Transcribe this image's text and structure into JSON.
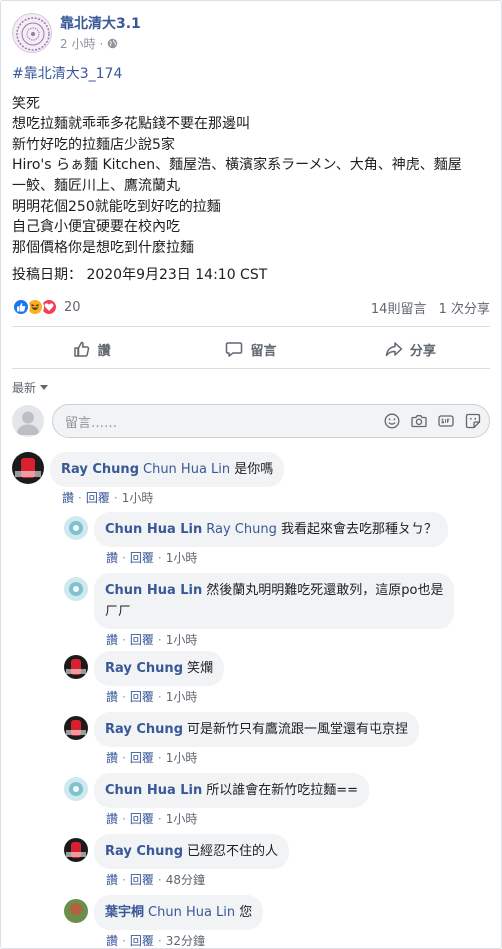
{
  "header": {
    "page_name": "靠北清大3.1",
    "time": "2 小時",
    "dot": "·"
  },
  "post": {
    "hashtag": "#靠北清大3_174",
    "lines": [
      "笑死",
      "想吃拉麵就乖乖多花點錢不要在那邊叫",
      "新竹好吃的拉麵店少說5家",
      "Hiro's らぁ麵 Kitchen、麵屋浩、橫濱家系ラーメン、大角、神虎、麵屋",
      "一鮫、麵匠川上、鷹流蘭丸",
      "明明花個250就能吃到好吃的拉麵",
      "自己貪小便宜硬要在校內吃",
      "那個價格你是想吃到什麼拉麵"
    ],
    "date": "投稿日期： 2020年9月23日 14:10 CST"
  },
  "reactions": {
    "count": "20",
    "comments": "14則留言",
    "shares": "1 次分享",
    "colors": {
      "like": "#1877f2",
      "haha": "#f7b125",
      "love": "#f33e58"
    }
  },
  "actions": {
    "like": "讚",
    "comment": "留言",
    "share": "分享"
  },
  "comments_section": {
    "sort_label": "最新",
    "composer_placeholder": "留言……"
  },
  "comments": [
    {
      "author": "Ray Chung",
      "mention": "Chun Hua Lin",
      "text": "是你嗎",
      "lines": [],
      "like": "讚",
      "reply": "回覆",
      "time": "1小時"
    },
    {
      "author": "Chun Hua Lin",
      "mention": "Ray Chung",
      "text": "我看起來會去吃那種ㄆㄅ？",
      "lines": [],
      "like": "讚",
      "reply": "回覆",
      "time": "1小時"
    },
    {
      "author": "Chun Hua Lin",
      "mention": "",
      "text": "",
      "lines": [
        "然後蘭丸明明難吃死還敢列，這原po也是",
        "ㄏㄏ"
      ],
      "like": "讚",
      "reply": "回覆",
      "time": "1小時"
    },
    {
      "author": "Ray Chung",
      "mention": "",
      "text": "笑爛",
      "lines": [],
      "like": "讚",
      "reply": "回覆",
      "time": "1小時"
    },
    {
      "author": "Ray Chung",
      "mention": "",
      "text": "可是新竹只有鷹流跟一風堂還有屯京捏",
      "lines": [],
      "like": "讚",
      "reply": "回覆",
      "time": "1小時"
    },
    {
      "author": "Chun Hua Lin",
      "mention": "",
      "text": "所以誰會在新竹吃拉麵==",
      "lines": [],
      "like": "讚",
      "reply": "回覆",
      "time": "1小時"
    },
    {
      "author": "Ray Chung",
      "mention": "",
      "text": "已經忍不住的人",
      "lines": [],
      "like": "讚",
      "reply": "回覆",
      "time": "48分鐘"
    },
    {
      "author": "葉宇桐",
      "mention": "Chun Hua Lin",
      "text": "您",
      "lines": [],
      "like": "讚",
      "reply": "回覆",
      "time": "32分鐘"
    }
  ]
}
